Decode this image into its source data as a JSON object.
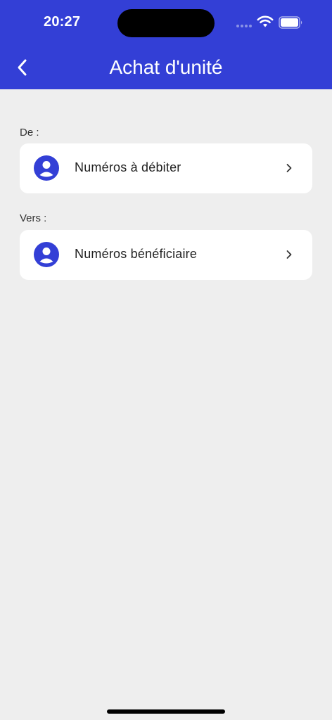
{
  "status_bar": {
    "time": "20:27"
  },
  "header": {
    "title": "Achat d'unité",
    "back_icon": "chevron-left-icon"
  },
  "from_section": {
    "label": "De :",
    "card_label": "Numéros à débiter",
    "icon": "user-avatar-icon"
  },
  "to_section": {
    "label": "Vers :",
    "card_label": "Numéros bénéficiaire",
    "icon": "user-avatar-icon"
  },
  "colors": {
    "primary": "#333fd6",
    "background": "#eeeeee",
    "card": "#ffffff",
    "text": "#222222"
  }
}
